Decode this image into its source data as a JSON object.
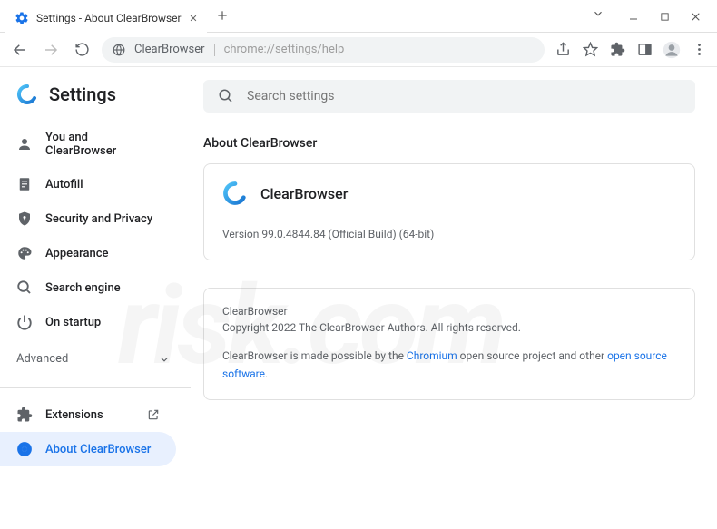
{
  "window": {
    "tab_title": "Settings - About ClearBrowser"
  },
  "toolbar": {
    "addr_prefix": "ClearBrowser",
    "addr_url": "chrome://settings/help"
  },
  "sidebar": {
    "title": "Settings",
    "items": [
      {
        "label": "You and ClearBrowser"
      },
      {
        "label": "Autofill"
      },
      {
        "label": "Security and Privacy"
      },
      {
        "label": "Appearance"
      },
      {
        "label": "Search engine"
      },
      {
        "label": "On startup"
      }
    ],
    "advanced_label": "Advanced",
    "extensions_label": "Extensions",
    "about_label": "About ClearBrowser"
  },
  "search": {
    "placeholder": "Search settings"
  },
  "main": {
    "section_title": "About ClearBrowser",
    "product_name": "ClearBrowser",
    "version_text": "Version 99.0.4844.84 (Official Build) (64-bit)",
    "footer_name": "ClearBrowser",
    "copyright": "Copyright 2022 The ClearBrowser Authors. All rights reserved.",
    "credits_prefix": "ClearBrowser is made possible by the ",
    "chromium_link": "Chromium",
    "credits_middle": " open source project and other ",
    "oss_link": "open source software",
    "credits_suffix": "."
  },
  "watermark": "risk.com"
}
